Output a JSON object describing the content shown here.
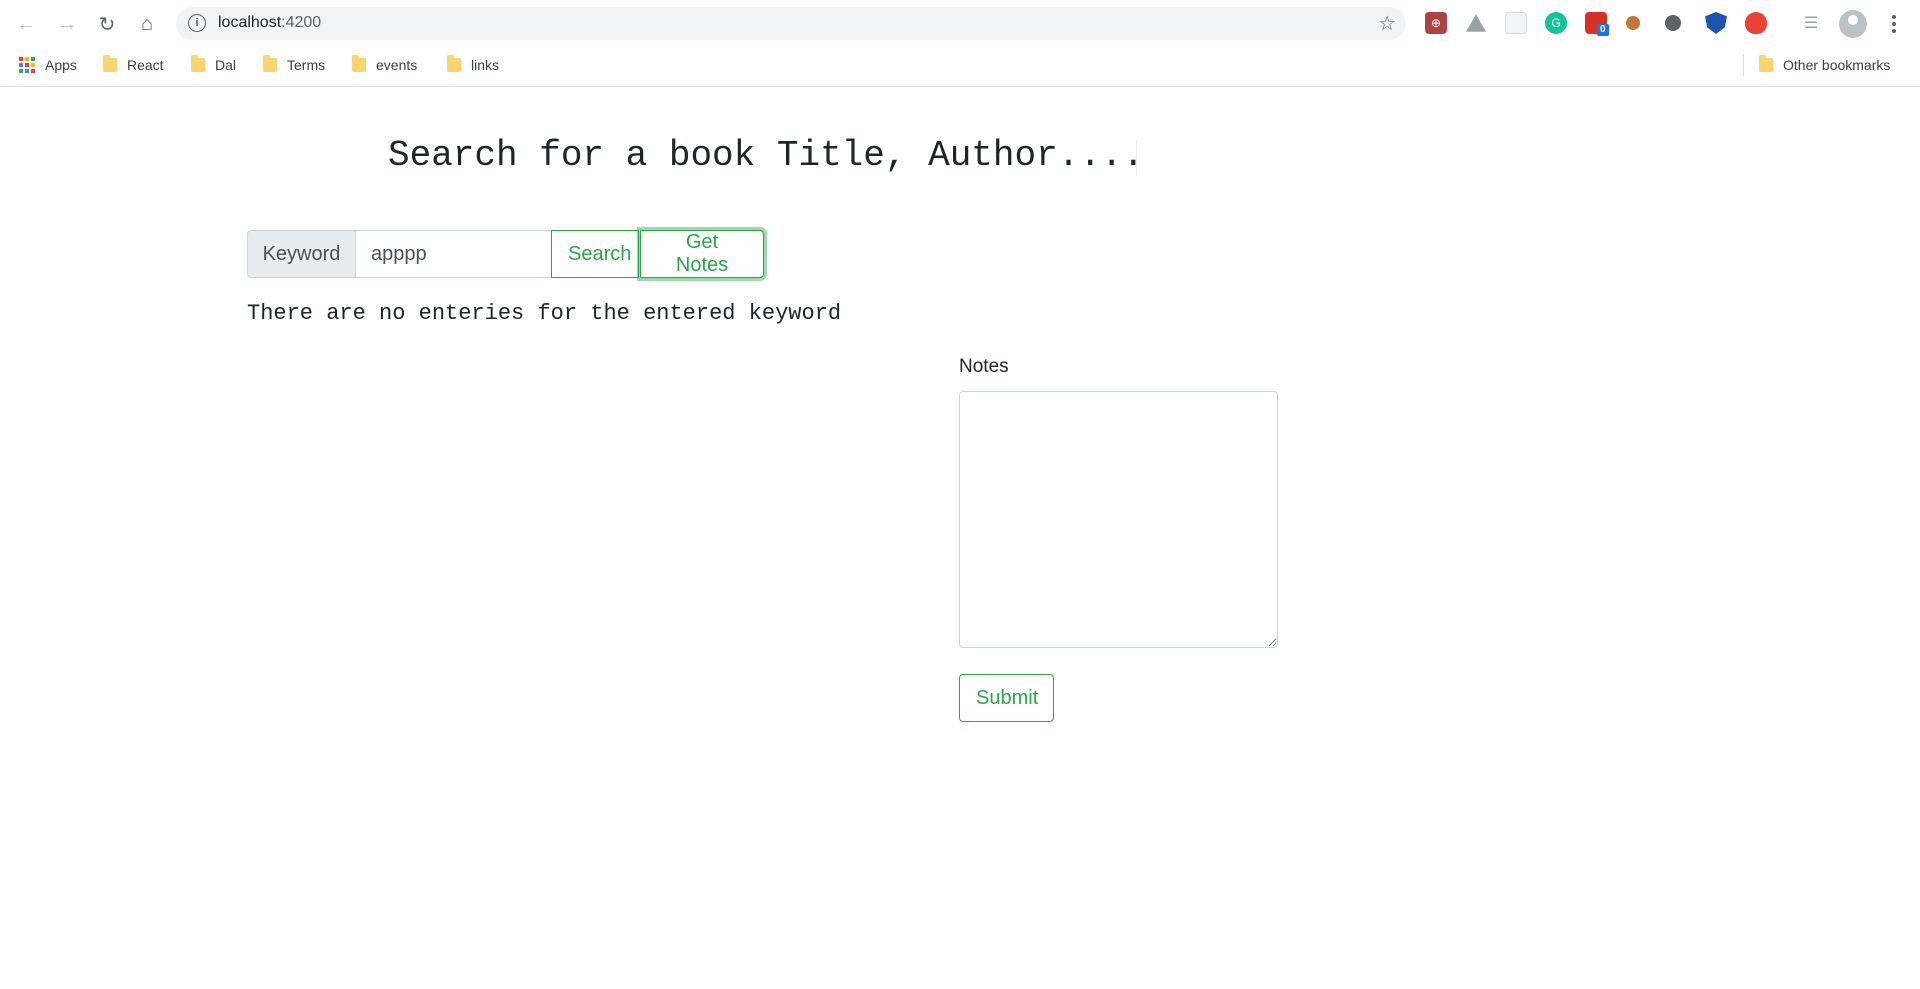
{
  "browser": {
    "url_host": "localhost",
    "url_port": ":4200",
    "bookmarks": [
      {
        "label": "Apps"
      },
      {
        "label": "React"
      },
      {
        "label": "Dal"
      },
      {
        "label": "Terms"
      },
      {
        "label": "events"
      },
      {
        "label": "links"
      }
    ],
    "other_bookmarks": "Other bookmarks",
    "extension_badge": "0"
  },
  "page": {
    "title": "Search for a book Title, Author....",
    "search": {
      "label": "Keyword",
      "value": "apppp",
      "search_button": "Search",
      "notes_button": "Get Notes"
    },
    "message": "There are no enteries for the entered keyword",
    "notes": {
      "label": "Notes",
      "value": "",
      "submit_button": "Submit"
    }
  },
  "colors": {
    "accent": "#28a745",
    "text": "#212529"
  }
}
